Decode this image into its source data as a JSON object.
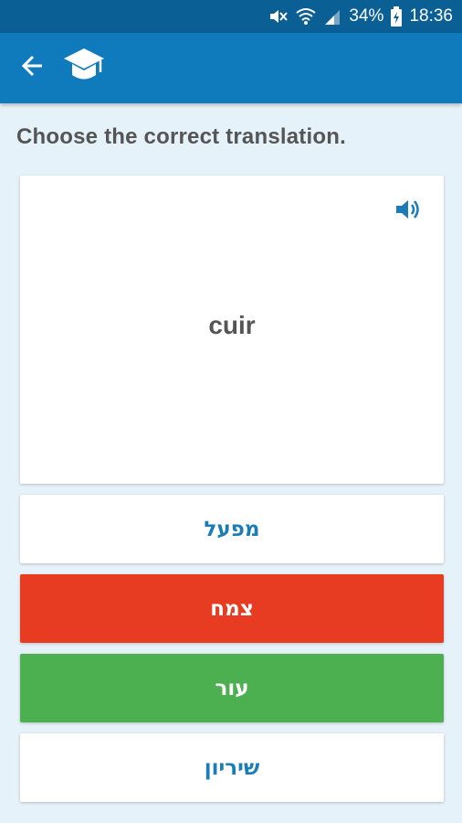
{
  "status_bar": {
    "battery_percent": "34%",
    "time": "18:36",
    "icons": [
      "mute-icon",
      "wifi-icon",
      "signal-icon",
      "battery-charging-icon"
    ]
  },
  "app_bar": {
    "back_icon": "arrow-left-icon",
    "logo_icon": "graduation-cap-icon",
    "color": "#0f7bbd"
  },
  "quiz": {
    "instruction": "Choose the correct translation.",
    "word": "cuir",
    "audio_icon": "speaker-icon",
    "answers": [
      {
        "label": "מפעל",
        "state": "neutral"
      },
      {
        "label": "צמח",
        "state": "wrong"
      },
      {
        "label": "עור",
        "state": "correct"
      },
      {
        "label": "שיריון",
        "state": "neutral"
      }
    ]
  },
  "colors": {
    "background": "#e6f2f9",
    "status_bar": "#0a5f95",
    "wrong": "#e73c22",
    "correct": "#4caf50",
    "answer_text": "#1b7cb8"
  }
}
